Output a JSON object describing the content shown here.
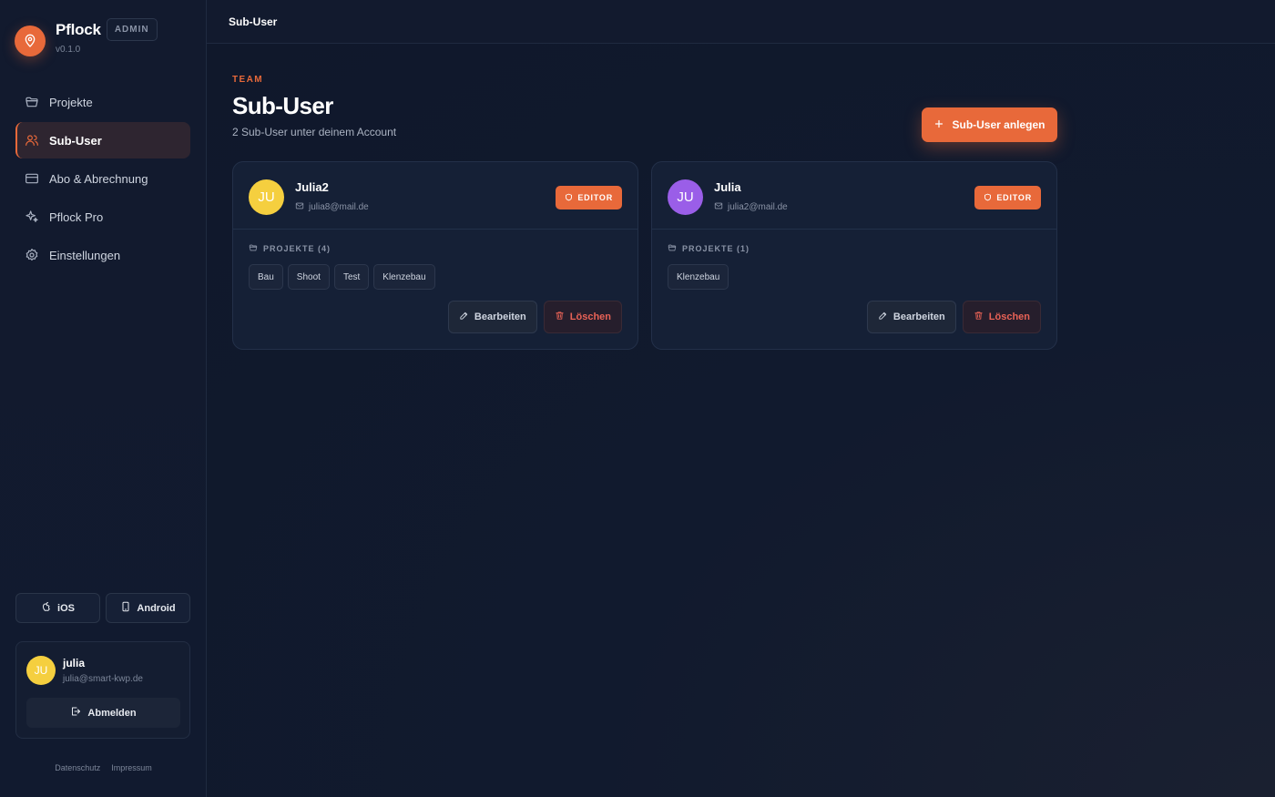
{
  "brand": {
    "name": "Pflock",
    "badge": "ADMIN",
    "version": "v0.1.0"
  },
  "nav": {
    "items": [
      {
        "label": "Projekte",
        "icon": "folder-icon",
        "active": false
      },
      {
        "label": "Sub-User",
        "icon": "users-icon",
        "active": true
      },
      {
        "label": "Abo & Abrechnung",
        "icon": "credit-card-icon",
        "active": false
      },
      {
        "label": "Pflock Pro",
        "icon": "sparkles-icon",
        "active": false
      },
      {
        "label": "Einstellungen",
        "icon": "gear-icon",
        "active": false
      }
    ]
  },
  "apps": {
    "ios": "iOS",
    "android": "Android"
  },
  "user": {
    "initials": "JU",
    "name": "julia",
    "email": "julia@smart-kwp.de",
    "logout": "Abmelden"
  },
  "footer": {
    "privacy": "Datenschutz",
    "imprint": "Impressum"
  },
  "topbar": {
    "title": "Sub-User"
  },
  "page": {
    "eyebrow": "TEAM",
    "title": "Sub-User",
    "subtitle": "2 Sub-User unter deinem Account",
    "create_button": "Sub-User anlegen"
  },
  "cards": [
    {
      "initials": "JU",
      "name": "Julia2",
      "email": "julia8@mail.de",
      "role": "EDITOR",
      "avatar_color": "#f5cf3f",
      "projects_label": "PROJEKTE (4)",
      "projects": [
        "Bau",
        "Shoot",
        "Test",
        "Klenzebau"
      ],
      "edit": "Bearbeiten",
      "delete": "Löschen"
    },
    {
      "initials": "JU",
      "name": "Julia",
      "email": "julia2@mail.de",
      "role": "EDITOR",
      "avatar_color": "#9a5ee8",
      "projects_label": "PROJEKTE (1)",
      "projects": [
        "Klenzebau"
      ],
      "edit": "Bearbeiten",
      "delete": "Löschen"
    }
  ],
  "colors": {
    "accent": "#e8693a",
    "danger": "#e86256",
    "background": "#0f1729"
  }
}
